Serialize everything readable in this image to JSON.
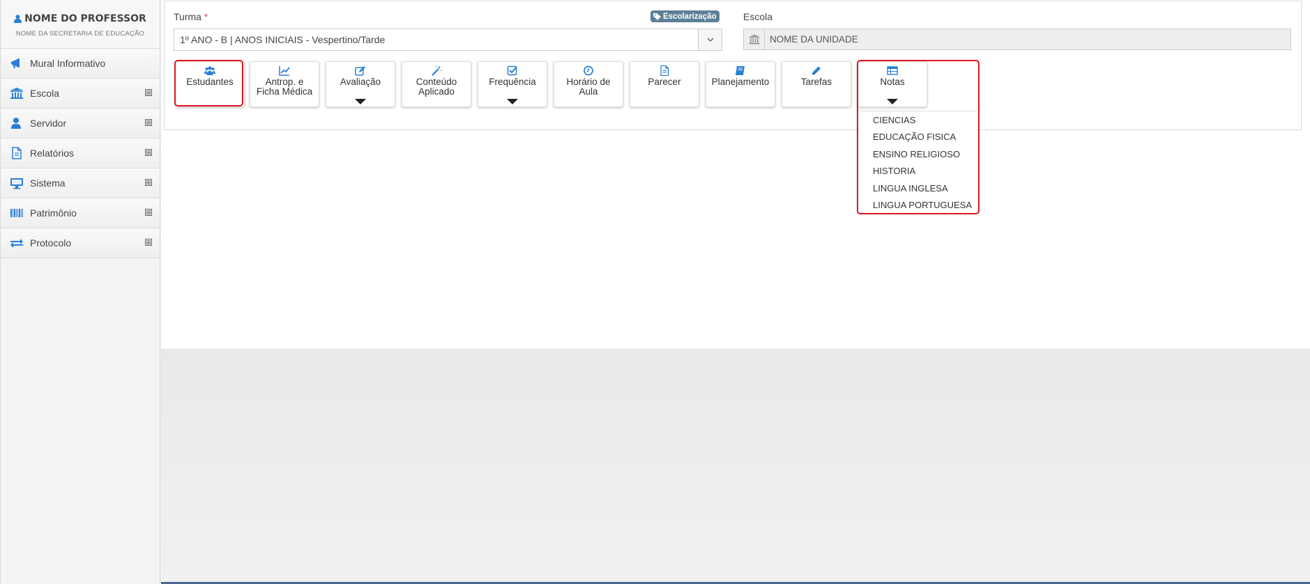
{
  "profile": {
    "name": "NOME DO PROFESSOR",
    "subtitle": "NOME DA SECRETARIA DE EDUCAÇÃO"
  },
  "sidebar": {
    "items": [
      {
        "label": "Mural Informativo",
        "icon": "megaphone-icon",
        "expandable": false
      },
      {
        "label": "Escola",
        "icon": "institution-icon",
        "expandable": true
      },
      {
        "label": "Servidor",
        "icon": "user-icon",
        "expandable": true
      },
      {
        "label": "Relatórios",
        "icon": "file-icon",
        "expandable": true
      },
      {
        "label": "Sistema",
        "icon": "monitor-icon",
        "expandable": true
      },
      {
        "label": "Patrimônio",
        "icon": "barcode-icon",
        "expandable": true
      },
      {
        "label": "Protocolo",
        "icon": "exchange-icon",
        "expandable": true
      }
    ],
    "expand_symbol": "⊞"
  },
  "form": {
    "turma_label": "Turma",
    "required_mark": "*",
    "badge_label": "Escolarização",
    "turma_value": "1º ANO - B | ANOS INICIAIS - Vespertino/Tarde",
    "escola_label": "Escola",
    "escola_value": "NOME DA UNIDADE"
  },
  "toolbar": {
    "buttons": [
      {
        "label": "Estudantes",
        "icon": "users-icon",
        "has_dropdown": false,
        "highlighted": true
      },
      {
        "label": "Antrop. e Ficha Médica",
        "icon": "line-chart-icon",
        "has_dropdown": false
      },
      {
        "label": "Avaliação",
        "icon": "edit-icon",
        "has_dropdown": true
      },
      {
        "label": "Conteúdo Aplicado",
        "icon": "magic-wand-icon",
        "has_dropdown": false
      },
      {
        "label": "Frequência",
        "icon": "check-square-icon",
        "has_dropdown": true
      },
      {
        "label": "Horário de Aula",
        "icon": "clock-icon",
        "has_dropdown": false
      },
      {
        "label": "Parecer",
        "icon": "document-icon",
        "has_dropdown": false
      },
      {
        "label": "Planejamento",
        "icon": "book-icon",
        "has_dropdown": false
      },
      {
        "label": "Tarefas",
        "icon": "pencil-icon",
        "has_dropdown": false
      },
      {
        "label": "Notas",
        "icon": "table-icon",
        "has_dropdown": true,
        "highlighted": true
      }
    ]
  },
  "notas_dropdown": {
    "items": [
      "CIENCIAS",
      "EDUCAÇÃO FISICA",
      "ENSINO RELIGIOSO",
      "HISTORIA",
      "LINGUA INGLESA",
      "LINGUA PORTUGUESA"
    ]
  },
  "colors": {
    "accent_icon": "#2a7fd4",
    "badge_bg": "#5c7f95",
    "highlight": "#e0141e",
    "required": "#d9534f"
  }
}
